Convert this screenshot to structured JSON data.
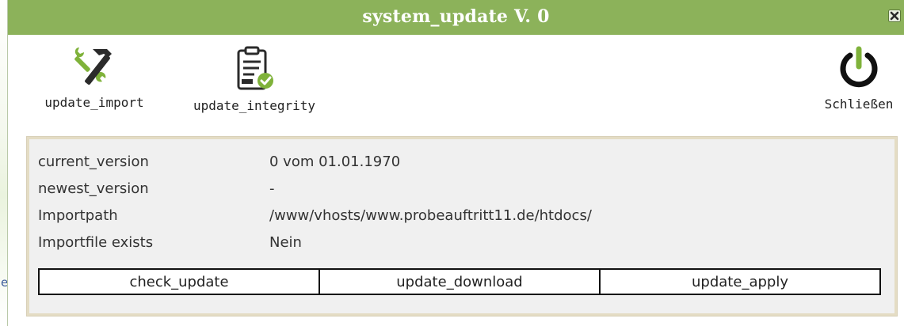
{
  "window": {
    "title": "system_update V. 0"
  },
  "toolbar": {
    "import_label": "update_import",
    "integrity_label": "update_integrity",
    "close_label": "Schließen"
  },
  "info": {
    "rows": [
      {
        "key": "current_version",
        "value": "0 vom 01.01.1970"
      },
      {
        "key": "newest_version",
        "value": "-"
      },
      {
        "key": "Importpath",
        "value": "/www/vhosts/www.probeauftritt11.de/htdocs/"
      },
      {
        "key": "Importfile exists",
        "value": "Nein"
      }
    ]
  },
  "actions": {
    "check_label": "check_update",
    "download_label": "update_download",
    "apply_label": "update_apply"
  },
  "background": {
    "edge_letter": "e"
  },
  "colors": {
    "titlebar": "#8cb25a",
    "accent_green": "#7fb23a",
    "panel": "#f0f0f0"
  },
  "icons": {
    "import": "hammer-wrench-icon",
    "integrity": "clipboard-check-icon",
    "close": "power-icon",
    "window_close": "close-icon"
  }
}
